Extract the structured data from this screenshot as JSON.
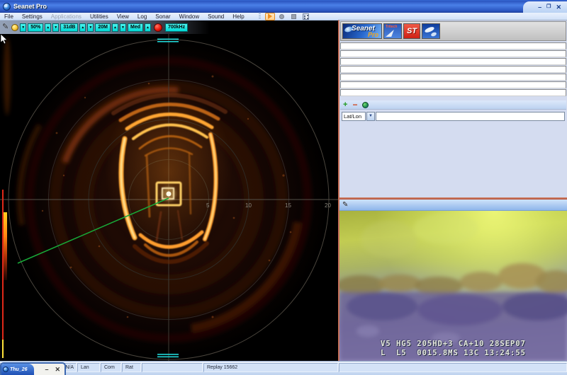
{
  "window": {
    "title": "Seanet Pro",
    "minimize": "–",
    "restore": "❐",
    "close": "✕"
  },
  "menu": {
    "items": [
      {
        "label": "File"
      },
      {
        "label": "Settings"
      },
      {
        "label": "Applications",
        "disabled": true
      },
      {
        "label": "Utilities"
      },
      {
        "label": "View"
      },
      {
        "label": "Log"
      },
      {
        "label": "Sonar"
      },
      {
        "label": "Window"
      },
      {
        "label": "Sound"
      },
      {
        "label": "Help"
      }
    ]
  },
  "sonar_toolbar": {
    "gain": "50%",
    "threshold": "31dB",
    "range": "20M",
    "resolution": "Med",
    "frequency": "700kHz"
  },
  "sonar": {
    "range_labels": [
      "5",
      "10",
      "15",
      "20"
    ],
    "accent_colors": {
      "target": "#ffa530",
      "marker": "#22d8d8",
      "bearing_line": "#18a838"
    }
  },
  "right_panel": {
    "logos": {
      "seanet": "Seanet",
      "seanet_sub": "Pro",
      "tritech": "Tritech",
      "st": "ST"
    },
    "latlon_label": "Lat/Lon",
    "latlon_value": "",
    "dropdown_glyph": "▼"
  },
  "video": {
    "osd_line1": "V5 HG5 205HD+3 CA+10 28SEP07",
    "osd_line2": "L  L5  0015.8MS 13C 13:24:55"
  },
  "statusbar": {
    "fields": [
      "ul N/A",
      "Lan",
      "Com N/A",
      "Rat N/A",
      "",
      "Replay 15662",
      ""
    ]
  },
  "taskbar_window": {
    "title": "Thu_26",
    "minimize": "–",
    "close": "✕"
  }
}
